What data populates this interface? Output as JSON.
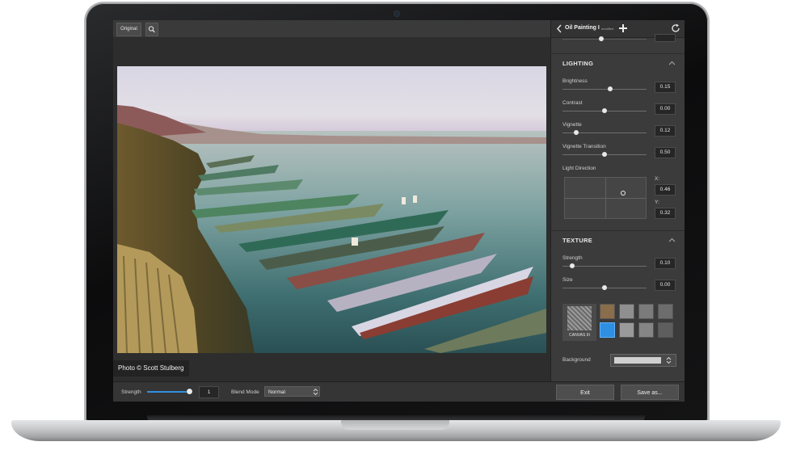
{
  "toolbar": {
    "original_label": "Original",
    "zoom_icon": "magnifier-icon"
  },
  "panel": {
    "preset_name": "Oil Painting I",
    "preset_state": "modified",
    "back_icon": "chevron-left-icon",
    "add_icon": "plus-icon",
    "reset_icon": "refresh-icon"
  },
  "lighting": {
    "title": "LIGHTING",
    "brightness": {
      "label": "Brightness",
      "value": "0.15",
      "level": 0.57
    },
    "contrast": {
      "label": "Contrast",
      "value": "0.00",
      "level": 0.5
    },
    "vignette": {
      "label": "Vignette",
      "value": "0.12",
      "level": 0.16
    },
    "vignette_transition": {
      "label": "Vignette Transition",
      "value": "0.50",
      "level": 0.5
    },
    "light_direction": {
      "label": "Light Direction",
      "x_label": "X:",
      "x_value": "0.46",
      "y_label": "Y:",
      "y_value": "0.32"
    }
  },
  "texture": {
    "title": "TEXTURE",
    "strength": {
      "label": "Strength",
      "value": "0.10",
      "level": 0.12
    },
    "size": {
      "label": "Size",
      "value": "0.00",
      "level": 0.5
    },
    "selected_texture_label": "CANVAS III",
    "background_label": "Background"
  },
  "photo": {
    "credit": "Photo © Scott Stulberg"
  },
  "bottom": {
    "strength_label": "Strength",
    "strength_value": "1",
    "strength_level": 1.0,
    "blend_mode_label": "Blend Mode",
    "blend_mode_value": "Normal",
    "exit_label": "Exit",
    "save_label": "Save as..."
  },
  "colors": {
    "accent": "#2f8fe0",
    "panel_bg": "#3b3b3b",
    "screen_bg": "#2b2b2b"
  }
}
